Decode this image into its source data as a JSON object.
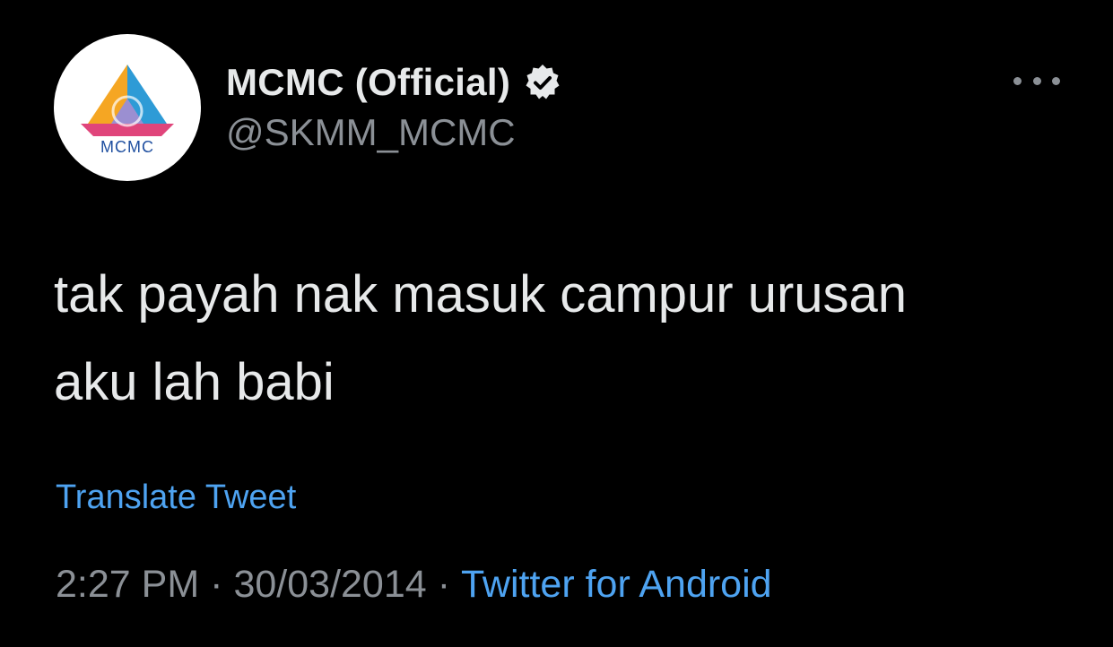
{
  "tweet": {
    "author": {
      "display_name": "MCMC (Official)",
      "handle": "@SKMM_MCMC",
      "verified": true,
      "avatar_logo_text": "MCMC"
    },
    "text": "tak payah nak masuk campur urusan\naku lah babi",
    "translate_label": "Translate Tweet",
    "time": "2:27 PM",
    "date": "30/03/2014",
    "separator": "·",
    "source": "Twitter for Android"
  },
  "icons": {
    "verified": "verified-badge-icon",
    "more": "more-horizontal-icon"
  },
  "colors": {
    "background": "#000000",
    "primary_text": "#e7e9ea",
    "secondary_text": "#8b9096",
    "link": "#4ea3f1"
  }
}
